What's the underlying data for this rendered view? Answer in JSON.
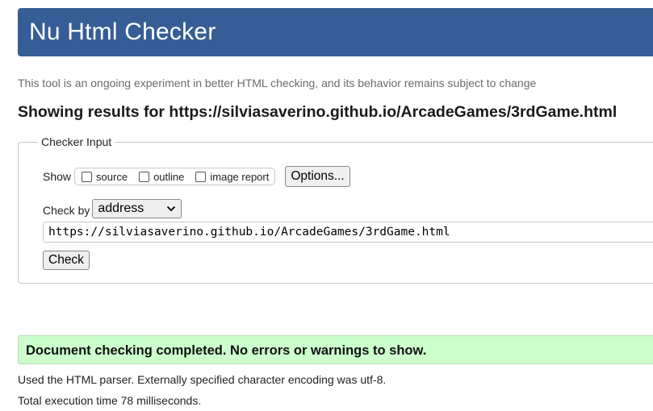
{
  "header": {
    "title": "Nu Html Checker"
  },
  "subtitle": "This tool is an ongoing experiment in better HTML checking, and its behavior remains subject to change",
  "results_heading": "Showing results for https://silviasaverino.github.io/ArcadeGames/3rdGame.html",
  "checker_input": {
    "legend": "Checker Input",
    "show_label": "Show",
    "options": [
      {
        "label": "source",
        "checked": false
      },
      {
        "label": "outline",
        "checked": false
      },
      {
        "label": "image report",
        "checked": false
      }
    ],
    "options_button": "Options...",
    "check_by_label": "Check by",
    "check_by_value": "address",
    "url_value": "https://silviasaverino.github.io/ArcadeGames/3rdGame.html",
    "check_button": "Check"
  },
  "result": {
    "message": "Document checking completed. No errors or warnings to show.",
    "parser_info": "Used the HTML parser. Externally specified character encoding was utf-8.",
    "execution_time": "Total execution time 78 milliseconds."
  },
  "colors": {
    "header_bg": "#365d95",
    "success_bg": "#ccffcc"
  }
}
